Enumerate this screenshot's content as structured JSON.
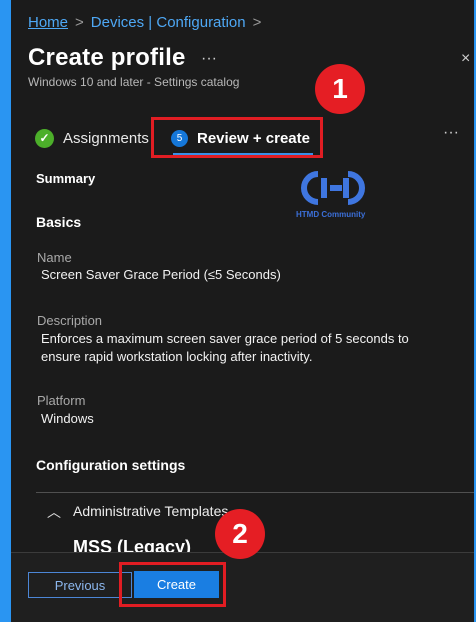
{
  "breadcrumb": {
    "home": "Home",
    "item": "Devices | Configuration",
    "separator": ">"
  },
  "page": {
    "title": "Create profile",
    "more": "···",
    "subtitle": "Windows 10 and later - Settings catalog",
    "close": "×"
  },
  "tabs": {
    "assignments": "Assignments",
    "review": "Review + create",
    "review_step": "5",
    "more": "···"
  },
  "summary": {
    "heading": "Summary",
    "basics_heading": "Basics",
    "name_label": "Name",
    "name_value": "Screen Saver Grace Period (≤5 Seconds)",
    "description_label": "Description",
    "description_value": "Enforces a maximum screen saver grace period of 5 seconds to ensure rapid workstation locking after inactivity.",
    "platform_label": "Platform",
    "platform_value": "Windows",
    "config_heading": "Configuration settings",
    "admin_templates": "Administrative Templates",
    "mss": "MSS (Legacy)"
  },
  "watermark": {
    "text": "HTMD Community"
  },
  "callouts": {
    "one": "1",
    "two": "2"
  },
  "footer": {
    "previous": "Previous",
    "create": "Create"
  },
  "colors": {
    "accent": "#1a7ee2",
    "annotation": "#e51e24",
    "frame": "#2a95f2",
    "success": "#4caf2a"
  }
}
